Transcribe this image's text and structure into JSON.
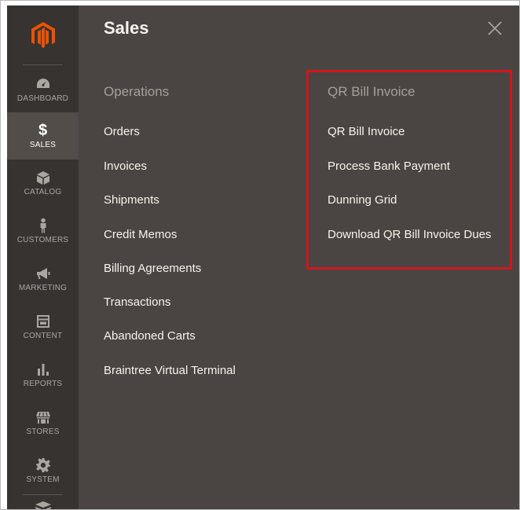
{
  "sidebar": {
    "logo_icon": "magento-logo-icon",
    "items": [
      {
        "label": "DASHBOARD",
        "icon": "speedometer-icon",
        "active": false
      },
      {
        "label": "SALES",
        "icon": "dollar-icon",
        "active": true,
        "glyph": "$"
      },
      {
        "label": "CATALOG",
        "icon": "box-icon",
        "active": false
      },
      {
        "label": "CUSTOMERS",
        "icon": "person-icon",
        "active": false
      },
      {
        "label": "MARKETING",
        "icon": "megaphone-icon",
        "active": false
      },
      {
        "label": "CONTENT",
        "icon": "layout-icon",
        "active": false
      },
      {
        "label": "REPORTS",
        "icon": "bar-chart-icon",
        "active": false
      },
      {
        "label": "STORES",
        "icon": "storefront-icon",
        "active": false
      },
      {
        "label": "SYSTEM",
        "icon": "gear-icon",
        "active": false
      }
    ],
    "partial_icon": "stack-icon"
  },
  "panel": {
    "title": "Sales",
    "close_icon": "close-icon",
    "operations": {
      "heading": "Operations",
      "links": [
        "Orders",
        "Invoices",
        "Shipments",
        "Credit Memos",
        "Billing Agreements",
        "Transactions",
        "Abandoned Carts",
        "Braintree Virtual Terminal"
      ]
    },
    "qr_bill": {
      "heading": "QR Bill Invoice",
      "links": [
        "QR Bill Invoice",
        "Process Bank Payment",
        "Dunning Grid",
        "Download QR Bill Invoice Dues"
      ]
    }
  },
  "colors": {
    "sidebar_bg": "#373330",
    "panel_bg": "#4a4542",
    "active_bg": "#524d49",
    "highlight": "#d0161f",
    "logo": "#eb5202"
  }
}
